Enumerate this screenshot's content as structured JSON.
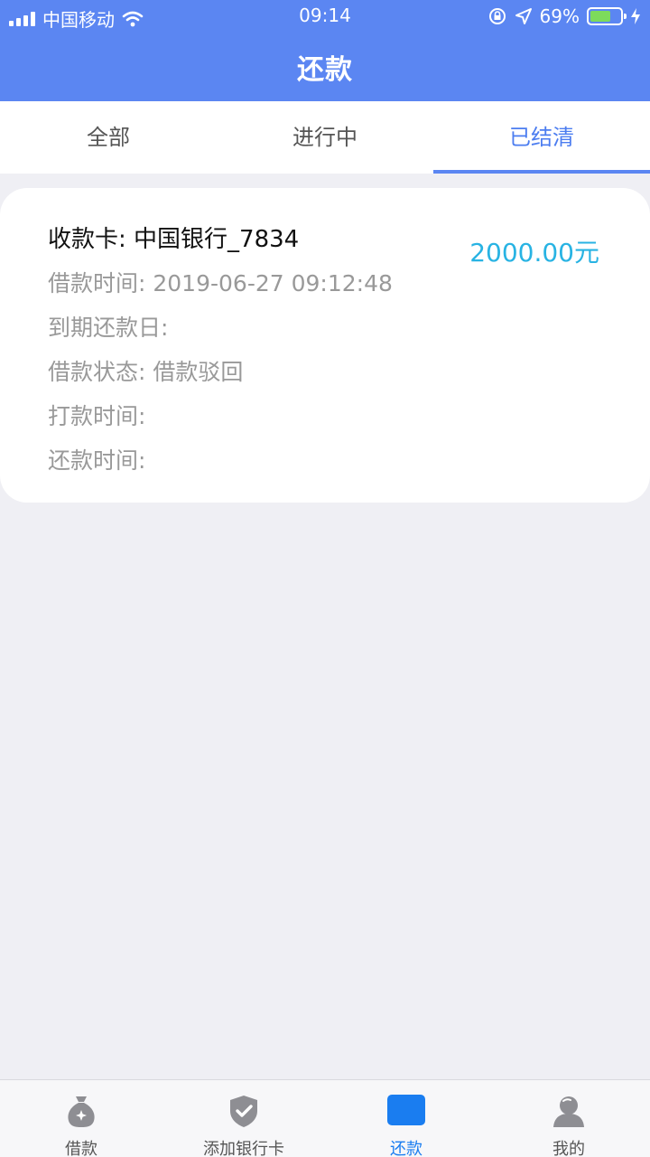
{
  "status_bar": {
    "carrier": "中国移动",
    "time": "09:14",
    "battery_percent": "69%",
    "battery_level": 0.69,
    "icons": [
      "signal-icon",
      "wifi-icon",
      "orientation-lock-icon",
      "location-icon",
      "battery-icon",
      "charging-icon"
    ]
  },
  "header": {
    "title": "还款"
  },
  "tabs": [
    {
      "label": "全部",
      "active": false
    },
    {
      "label": "进行中",
      "active": false
    },
    {
      "label": "已结清",
      "active": true
    }
  ],
  "record": {
    "card": "收款卡: 中国银行_7834",
    "loan_time": "借款时间: 2019-06-27 09:12:48",
    "due_date": "到期还款日:",
    "status": "借款状态: 借款驳回",
    "payout_time": "打款时间:",
    "repay_time": "还款时间:",
    "amount": "2000.00元"
  },
  "tabbar": [
    {
      "label": "借款",
      "icon": "money-bag-icon",
      "active": false
    },
    {
      "label": "添加银行卡",
      "icon": "shield-check-icon",
      "active": false
    },
    {
      "label": "还款",
      "icon": "repay-icon",
      "active": true
    },
    {
      "label": "我的",
      "icon": "user-icon",
      "active": false
    }
  ],
  "colors": {
    "accent": "#5b86f2",
    "tab_active_text": "#4c7df0",
    "amount": "#28b3e3",
    "tabbar_active": "#1a7df0"
  }
}
